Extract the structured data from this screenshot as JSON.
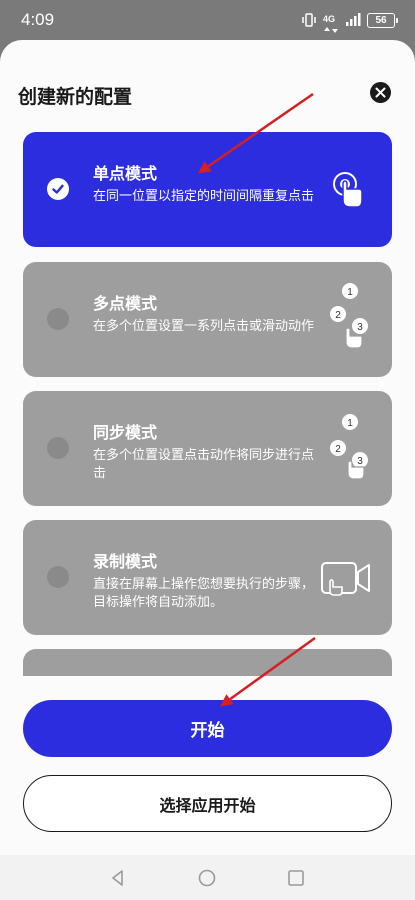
{
  "status_bar": {
    "time": "4:09",
    "network": "4G",
    "battery": "56"
  },
  "sheet": {
    "title": "创建新的配置",
    "close_icon": "close-icon"
  },
  "modes": [
    {
      "title": "单点模式",
      "description": "在同一位置以指定的时间间隔重复点击",
      "selected": true,
      "icon": "single-tap-icon"
    },
    {
      "title": "多点模式",
      "description": "在多个位置设置一系列点击或滑动动作",
      "selected": false,
      "icon": "multi-tap-icon"
    },
    {
      "title": "同步模式",
      "description": "在多个位置设置点击动作将同步进行点击",
      "selected": false,
      "icon": "sync-tap-icon"
    },
    {
      "title": "录制模式",
      "description": "直接在屏幕上操作您想要执行的步骤，目标操作将自动添加。",
      "selected": false,
      "icon": "record-video-icon"
    }
  ],
  "buttons": {
    "start": "开始",
    "select_app_start": "选择应用开始"
  },
  "colors": {
    "accent": "#2d2de0",
    "card_inactive": "#9e9e9e",
    "annotation_arrow": "#d42020"
  }
}
